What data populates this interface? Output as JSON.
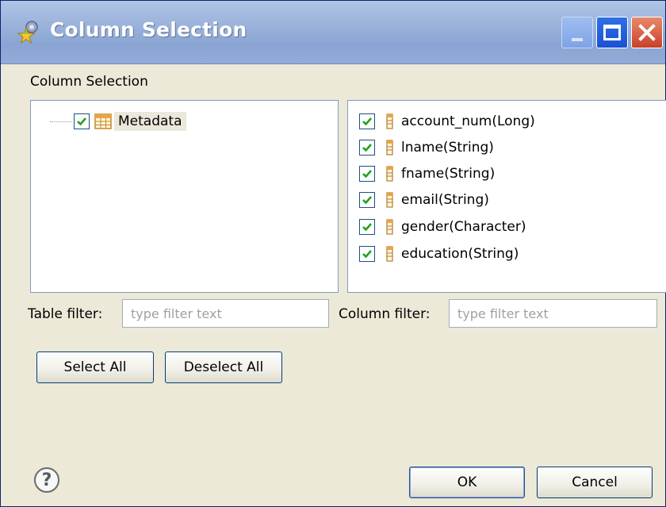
{
  "window": {
    "title": "Column Selection",
    "app_icon": "star-gear-icon"
  },
  "titlebar_buttons": {
    "minimize": "minimize-icon",
    "maximize": "maximize-icon",
    "close": "close-icon"
  },
  "section_label": "Column Selection",
  "table_tree": {
    "items": [
      {
        "label": "Metadata",
        "checked": true,
        "icon": "table-icon"
      }
    ]
  },
  "columns": {
    "items": [
      {
        "label": "account_num(Long)",
        "checked": true,
        "icon": "column-icon"
      },
      {
        "label": "lname(String)",
        "checked": true,
        "icon": "column-icon"
      },
      {
        "label": "fname(String)",
        "checked": true,
        "icon": "column-icon"
      },
      {
        "label": "email(String)",
        "checked": true,
        "icon": "column-icon"
      },
      {
        "label": "gender(Character)",
        "checked": true,
        "icon": "column-icon"
      },
      {
        "label": "education(String)",
        "checked": true,
        "icon": "column-icon"
      }
    ]
  },
  "filters": {
    "table_label": "Table filter:",
    "table_placeholder": "type filter text",
    "table_value": "",
    "column_label": "Column filter:",
    "column_placeholder": "type filter text",
    "column_value": ""
  },
  "buttons": {
    "select_all": "Select All",
    "deselect_all": "Deselect All",
    "ok": "OK",
    "cancel": "Cancel"
  },
  "help_icon": "help-icon",
  "colors": {
    "titlebar": "#9db4dc",
    "dialog_bg": "#ece9d8",
    "check_green": "#21a121",
    "close_red": "#c8402a"
  }
}
